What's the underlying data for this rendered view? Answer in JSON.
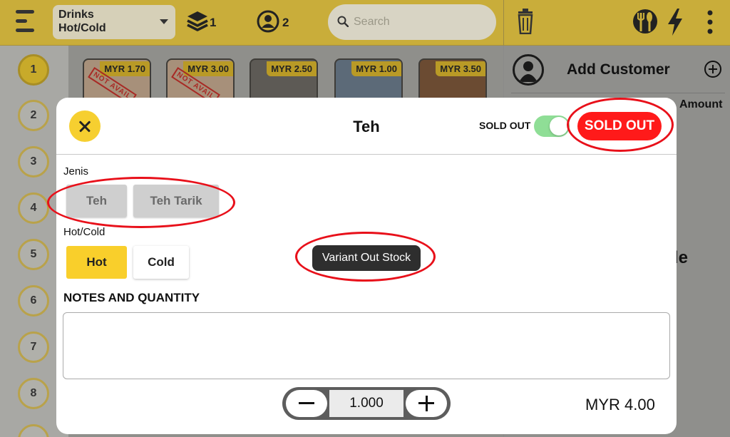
{
  "topbar": {
    "category_line1": "Drinks",
    "category_line2": "Hot/Cold",
    "layers_count": "1",
    "customers_count": "2",
    "search_placeholder": "Search"
  },
  "tables": [
    "1",
    "2",
    "3",
    "4",
    "5",
    "6",
    "7",
    "8"
  ],
  "products": [
    {
      "price": "MYR 1.70",
      "overlay": "NOT AVAIL"
    },
    {
      "price": "MYR 3.00",
      "overlay": "NOT AVAIL"
    },
    {
      "price": "MYR 2.50",
      "overlay": ""
    },
    {
      "price": "MYR 1.00",
      "overlay": ""
    },
    {
      "price": "MYR 3.50",
      "overlay": ""
    }
  ],
  "right_panel": {
    "add_customer": "Add Customer",
    "amount_header": "Amount",
    "partial_text": "le"
  },
  "modal": {
    "title": "Teh",
    "sold_out_toggle_label": "SOLD OUT",
    "sold_out_toggle_on": true,
    "sold_out_button": "SOLD OUT",
    "variant_group_1": {
      "label": "Jenis",
      "options": [
        "Teh",
        "Teh Tarik"
      ]
    },
    "variant_group_2": {
      "label": "Hot/Cold",
      "options": [
        "Hot",
        "Cold"
      ],
      "selected": "Hot"
    },
    "tooltip": "Variant Out Stock",
    "notes_title": "NOTES AND QUANTITY",
    "notes_value": "",
    "quantity": "1.000",
    "total": "MYR 4.00"
  },
  "colors": {
    "accent_yellow": "#f9cf2b",
    "sold_out_red": "#ff1a1a",
    "toggle_green": "#8fde96",
    "annotation_red": "#e8101a"
  }
}
